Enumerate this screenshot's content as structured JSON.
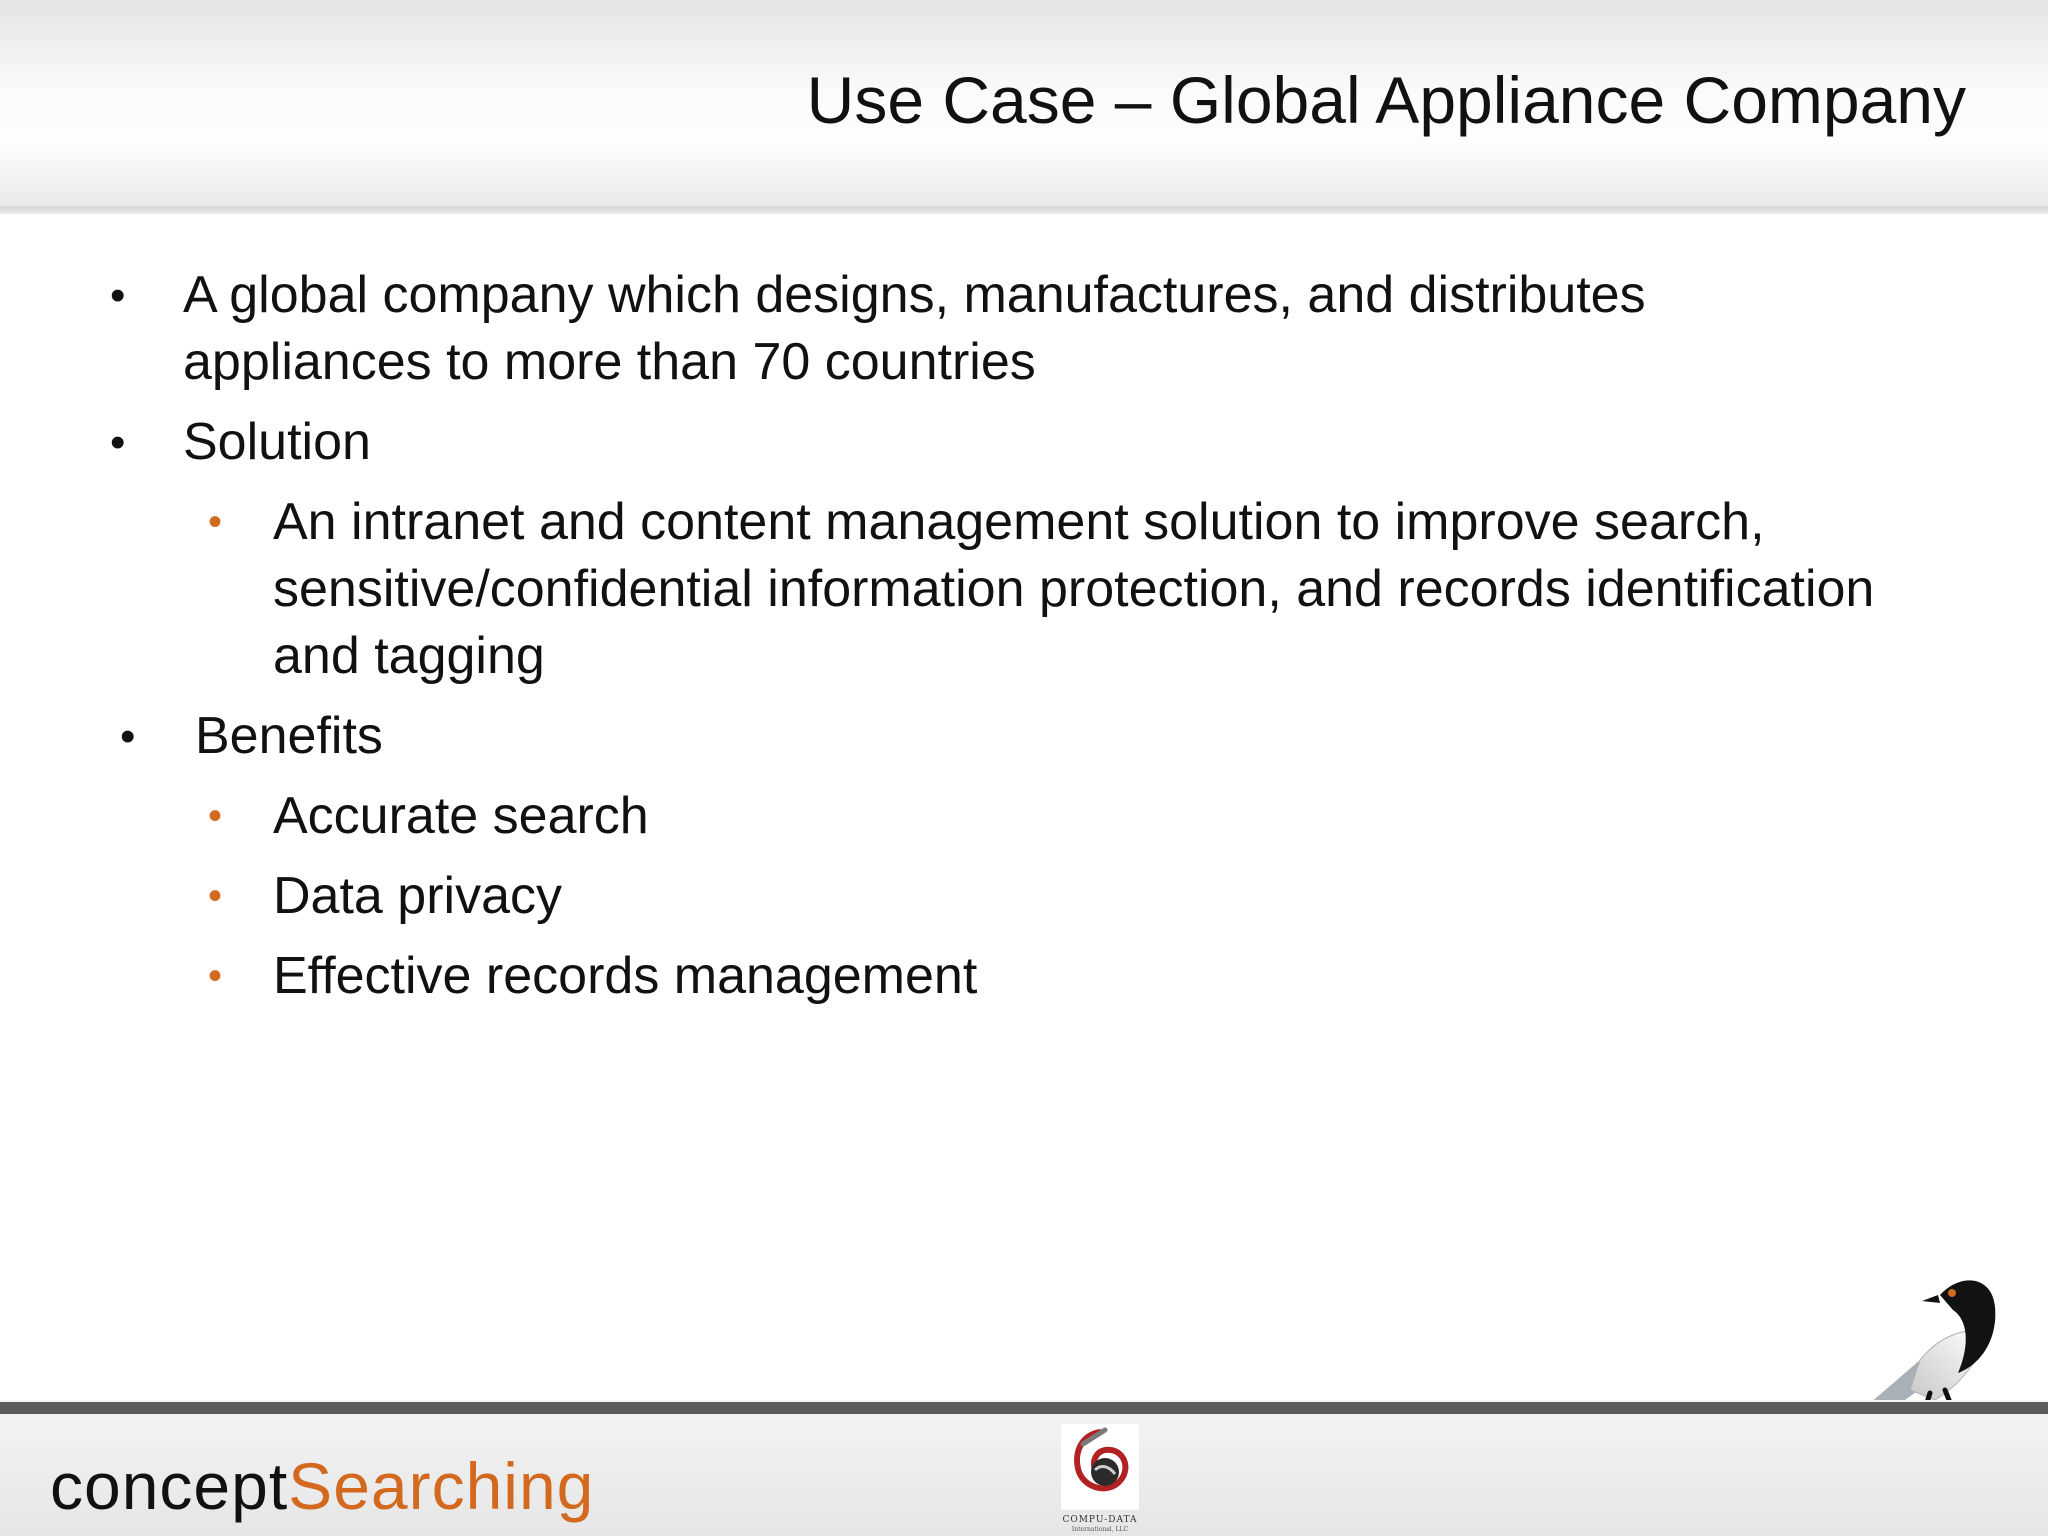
{
  "slide": {
    "title": "Use Case – Global Appliance Company",
    "bullets": [
      {
        "text": "A global company which designs, manufactures, and distributes\nappliances to more than 70 countries",
        "level": 1
      },
      {
        "text": "Solution",
        "level": 1
      },
      {
        "text": "An intranet and content management solution to improve search,\nsensitive/confidential information protection, and records identification\nand tagging",
        "level": 2
      },
      {
        "text": "Benefits",
        "level": 1
      },
      {
        "text": "Accurate search",
        "level": 2
      },
      {
        "text": "Data privacy",
        "level": 2
      },
      {
        "text": "Effective records management",
        "level": 2
      }
    ],
    "bullet_glyph": "•",
    "bullet_color_level2": "#d2691e"
  },
  "footer": {
    "logo_part1": "concept",
    "logo_part2": "Searching",
    "logo_accent_color": "#d2691e",
    "center_logo_caption": "COMPU-DATA",
    "center_logo_subcaption": "International, LLC",
    "icons": [
      "compu-data-logo-icon",
      "magpie-bird-icon"
    ]
  }
}
